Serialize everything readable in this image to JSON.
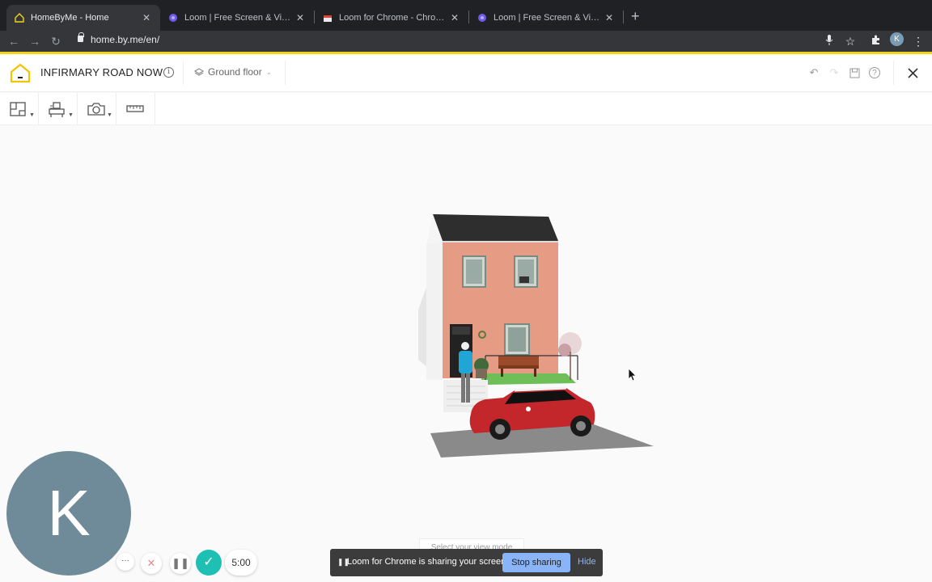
{
  "browser": {
    "tabs": [
      {
        "title": "HomeByMe - Home",
        "active": true
      },
      {
        "title": "Loom | Free Screen & Video Re",
        "active": false
      },
      {
        "title": "Loom for Chrome - Chrome We",
        "active": false
      },
      {
        "title": "Loom | Free Screen & Video Re",
        "active": false
      }
    ],
    "new_tab": "+",
    "url": "home.by.me/en/",
    "profile_initial": "K"
  },
  "app": {
    "project_title": "INFIRMARY ROAD NOW",
    "info_symbol": "i",
    "floor_selector": "Ground floor"
  },
  "loom": {
    "avatar_letter": "K",
    "timer": "5:00",
    "more": "···"
  },
  "view_mode_hint": "Select your view mode",
  "sharing_banner": {
    "message": "Loom for Chrome is sharing your screen.",
    "stop_label": "Stop sharing",
    "hide_label": "Hide"
  },
  "colors": {
    "brand_yellow": "#f3d41d",
    "loom_teal": "#1fc0b4",
    "chrome_dark": "#202124"
  }
}
